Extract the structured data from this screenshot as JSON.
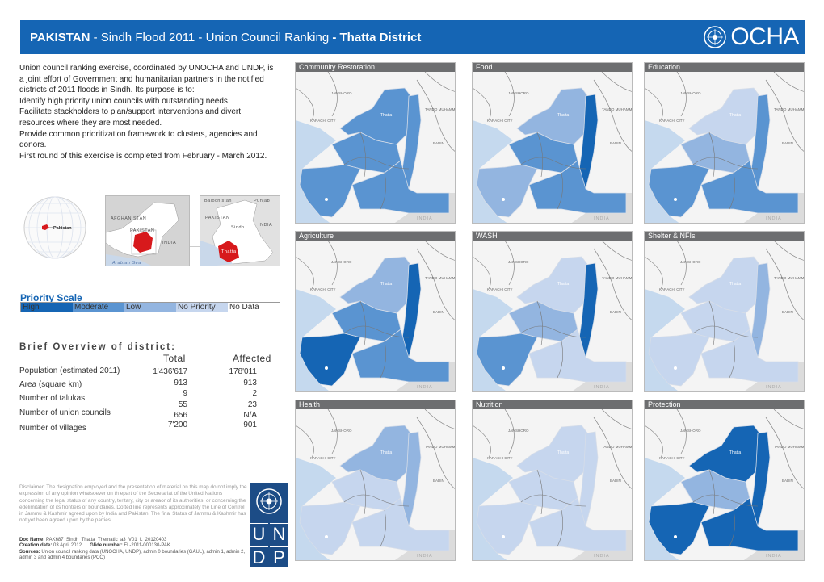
{
  "header": {
    "title_country": "PAKISTAN",
    "title_middle": " - Sindh Flood 2011 - Union Council Ranking ",
    "title_district": "- Thatta District",
    "logo_text": "OCHA",
    "logo_icon": "un-emblem-icon"
  },
  "intro": {
    "lines": [
      "Union council ranking exercise, coordinated by UNOCHA and UNDP, is a joint effort of Government and humanitarian partners in the notified districts of 2011 floods in Sindh. Its purpose is to:",
      "Identify high priority union councils with outstanding needs.",
      "Facilitate stackholders to plan/support interventions and divert resources where they are most needed.",
      "Provide common prioritization framework to clusters, agencies and donors.",
      "First round of this exercise is completed from February - March 2012."
    ]
  },
  "locator": {
    "globe_label": "Pakistan",
    "inset1": {
      "labels": [
        "AFGHANISTAN",
        "PAKISTAN",
        "INDIA",
        "Arabian Sea"
      ]
    },
    "inset2": {
      "labels": [
        "Balochistan",
        "Punjab",
        "PAKISTAN",
        "Sindh",
        "INDIA",
        "Thatta"
      ]
    },
    "highlight_color": "#d7191c"
  },
  "priority_scale": {
    "title": "Priority Scale",
    "levels": [
      {
        "label": "High",
        "color": "#1565b4"
      },
      {
        "label": "Moderate",
        "color": "#5a94d1"
      },
      {
        "label": "Low",
        "color": "#93b5e0"
      },
      {
        "label": "No Priority",
        "color": "#c6d6ee"
      },
      {
        "label": "No Data",
        "color": "#ffffff"
      }
    ]
  },
  "overview": {
    "title": "Brief Overview of district:",
    "col_total": "Total",
    "col_affected": "Affected",
    "rows": [
      {
        "label": "Population (estimated 2011)",
        "total": "1'436'617",
        "affected": "178'011"
      },
      {
        "label": "Area (square km)",
        "total": "913",
        "affected": "913"
      },
      {
        "label": "Number of  talukas",
        "total": "9",
        "affected": "2"
      },
      {
        "label": "",
        "total": "55",
        "affected": "23"
      },
      {
        "label": "Number of union councils",
        "total": "656",
        "affected": "N/A"
      },
      {
        "label": "Number of villages",
        "total": "7'200",
        "affected": "901"
      }
    ]
  },
  "disclaimer": {
    "text": "Disclaimer: The designation employed and the presentation of material on this map do not imply the expression of any opinion whatsoever on th epart of the Secretariat of the United Nations concerning the legal status of any country, teritary, city or areaor of its authorities, or concerning the edelimitation of its frontiers or boundaries. Dotted line represents approximately the Line of Control in Jammu & Kashmir agreed upon by India and Pakistan. The final Status of Jammu & Kashmir has not yet been agreed upon by the parties.",
    "doc_name_label": "Doc Name:",
    "doc_name": "PAK687_Sindh_Thatta_Thematic_a3_V01_L_20120403",
    "creation_label": "Creation date:",
    "creation_date": "03 April 2012",
    "glide_label": "Glide number:",
    "glide_number": "FL-2011-000130-PAK",
    "sources_label": "Sources:",
    "sources": "Union council ranking data (UNOCHA, UNDP), admin 0 boundaries (GAUL), admin 1, admin 2, admin 3 and admin 4 boundaries (PCO)"
  },
  "undp_logo": {
    "letters": [
      "U",
      "N",
      "D",
      "P"
    ]
  },
  "map_labels": {
    "jamshoro": "JAMSHORO",
    "karachi": "KARACHI CITY",
    "tando": "TANDO MUHAMMAD KHAN",
    "badin": "BADIN",
    "india": "INDIA",
    "thatta": "Thatta"
  },
  "panels": [
    {
      "title": "Community Restoration",
      "scheme": [
        "#5a94d1",
        "#5a94d1",
        "#5a94d1",
        "#5a94d1",
        "#5a94d1"
      ]
    },
    {
      "title": "Food",
      "scheme": [
        "#93b5e0",
        "#1565b4",
        "#5a94d1",
        "#93b5e0",
        "#5a94d1"
      ]
    },
    {
      "title": "Education",
      "scheme": [
        "#c6d6ee",
        "#5a94d1",
        "#93b5e0",
        "#5a94d1",
        "#5a94d1"
      ]
    },
    {
      "title": "Agriculture",
      "scheme": [
        "#93b5e0",
        "#1565b4",
        "#5a94d1",
        "#1565b4",
        "#5a94d1"
      ]
    },
    {
      "title": "WASH",
      "scheme": [
        "#c6d6ee",
        "#1565b4",
        "#93b5e0",
        "#5a94d1",
        "#c6d6ee"
      ]
    },
    {
      "title": "Shelter & NFIs",
      "scheme": [
        "#c6d6ee",
        "#93b5e0",
        "#c6d6ee",
        "#c6d6ee",
        "#c6d6ee"
      ]
    },
    {
      "title": "Health",
      "scheme": [
        "#93b5e0",
        "#93b5e0",
        "#c6d6ee",
        "#c6d6ee",
        "#c6d6ee"
      ]
    },
    {
      "title": "Nutrition",
      "scheme": [
        "#c6d6ee",
        "#c6d6ee",
        "#c6d6ee",
        "#c6d6ee",
        "#c6d6ee"
      ]
    },
    {
      "title": "Protection",
      "scheme": [
        "#1565b4",
        "#1565b4",
        "#93b5e0",
        "#1565b4",
        "#1565b4"
      ]
    }
  ]
}
